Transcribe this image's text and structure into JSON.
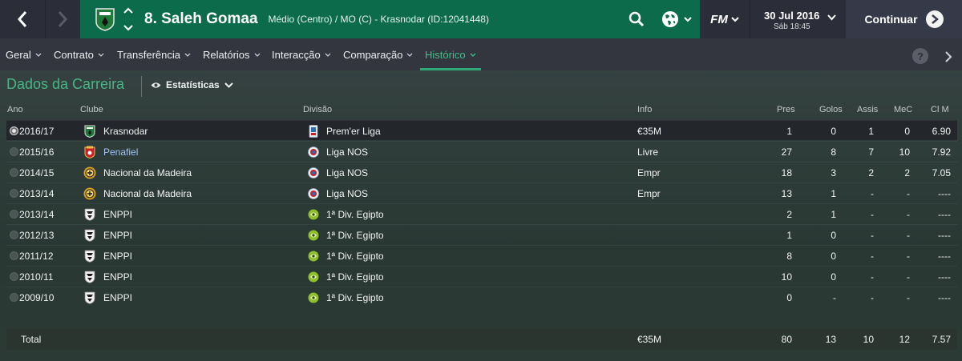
{
  "topbar": {
    "back_icon": "chevron-left-icon",
    "forward_icon": "chevron-right-icon",
    "player_name": "8. Saleh Gomaa",
    "player_subtitle": "Médio (Centro) / MO (C) - Krasnodar (ID:12041448)",
    "search_icon": "search-icon",
    "globe_icon": "globe-icon",
    "fm_label": "FM",
    "date": "30 Jul 2016",
    "time": "Sáb 18:45",
    "continue_label": "Continuar",
    "title_bg": "#0b6b4b"
  },
  "tabs": [
    {
      "label": "Geral"
    },
    {
      "label": "Contrato"
    },
    {
      "label": "Transferência"
    },
    {
      "label": "Relatórios"
    },
    {
      "label": "Interacção"
    },
    {
      "label": "Comparação"
    },
    {
      "label": "Histórico",
      "active": true
    }
  ],
  "help_label": "?",
  "section": {
    "title": "Dados da Carreira",
    "view_label": "Estatísticas"
  },
  "columns": {
    "ano": "Ano",
    "clube": "Clube",
    "divisao": "Divisão",
    "info": "Info",
    "pres": "Pres",
    "golos": "Golos",
    "assis": "Assis",
    "mec": "MeC",
    "clm": "Cl M"
  },
  "rows": [
    {
      "year": "2016/17",
      "club": "Krasnodar",
      "club_badge": "krasnodar",
      "division": "Prem'er Liga",
      "league_badge": "premier",
      "info": "€35M",
      "pres": "1",
      "golos": "0",
      "assis": "1",
      "mec": "0",
      "clm": "6.90"
    },
    {
      "year": "2015/16",
      "club": "Penafiel",
      "club_badge": "penafiel",
      "division": "Liga NOS",
      "league_badge": "liganos",
      "info": "Livre",
      "pres": "27",
      "golos": "8",
      "assis": "7",
      "mec": "10",
      "clm": "7.92"
    },
    {
      "year": "2014/15",
      "club": "Nacional da Madeira",
      "club_badge": "nacional",
      "division": "Liga NOS",
      "league_badge": "liganos",
      "info": "Empr",
      "pres": "18",
      "golos": "3",
      "assis": "2",
      "mec": "2",
      "clm": "7.05"
    },
    {
      "year": "2013/14",
      "club": "Nacional da Madeira",
      "club_badge": "nacional",
      "division": "Liga NOS",
      "league_badge": "liganos",
      "info": "Empr",
      "pres": "13",
      "golos": "1",
      "assis": "-",
      "mec": "-",
      "clm": "----"
    },
    {
      "year": "2013/14",
      "club": "ENPPI",
      "club_badge": "enppi",
      "division": "1ª Div. Egipto",
      "league_badge": "egypt",
      "info": "",
      "pres": "2",
      "golos": "1",
      "assis": "-",
      "mec": "-",
      "clm": "----"
    },
    {
      "year": "2012/13",
      "club": "ENPPI",
      "club_badge": "enppi",
      "division": "1ª Div. Egipto",
      "league_badge": "egypt",
      "info": "",
      "pres": "1",
      "golos": "0",
      "assis": "-",
      "mec": "-",
      "clm": "----"
    },
    {
      "year": "2011/12",
      "club": "ENPPI",
      "club_badge": "enppi",
      "division": "1ª Div. Egipto",
      "league_badge": "egypt",
      "info": "",
      "pres": "8",
      "golos": "0",
      "assis": "-",
      "mec": "-",
      "clm": "----"
    },
    {
      "year": "2010/11",
      "club": "ENPPI",
      "club_badge": "enppi",
      "division": "1ª Div. Egipto",
      "league_badge": "egypt",
      "info": "",
      "pres": "10",
      "golos": "0",
      "assis": "-",
      "mec": "-",
      "clm": "----"
    },
    {
      "year": "2009/10",
      "club": "ENPPI",
      "club_badge": "enppi",
      "division": "1ª Div. Egipto",
      "league_badge": "egypt",
      "info": "",
      "pres": "0",
      "golos": "-",
      "assis": "-",
      "mec": "-",
      "clm": "----"
    }
  ],
  "total": {
    "label": "Total",
    "info": "€35M",
    "pres": "80",
    "golos": "13",
    "assis": "10",
    "mec": "12",
    "clm": "7.57"
  },
  "colors": {
    "accent": "#49b586",
    "link": "#9fc2f2",
    "topbar": "#2b2d38",
    "tabbar": "#33353f"
  }
}
